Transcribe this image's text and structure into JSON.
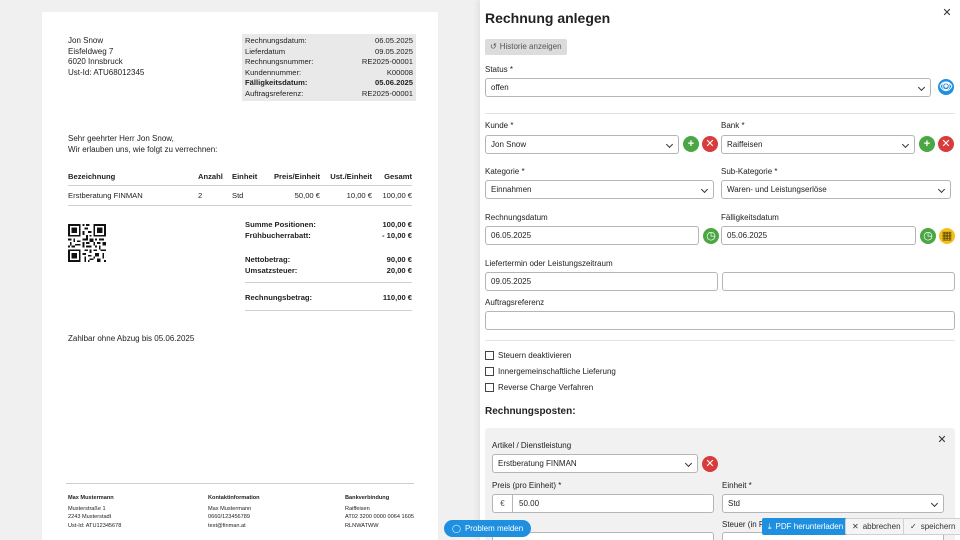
{
  "invoice": {
    "sender": [
      "Jon Snow",
      "Eisfeldweg 7",
      "6020 Innsbruck",
      "Ust-Id: ATU68012345"
    ],
    "meta": [
      {
        "label": "Rechnungsdatum:",
        "value": "06.05.2025"
      },
      {
        "label": "Lieferdatum",
        "value": "09.05.2025"
      },
      {
        "label": "Rechnungsnummer:",
        "value": "RE2025-00001"
      },
      {
        "label": "Kundennummer:",
        "value": "K00008"
      },
      {
        "label": "Fälligkeitsdatum:",
        "value": "05.06.2025"
      },
      {
        "label": "Auftragsreferenz:",
        "value": "RE2025-00001"
      }
    ],
    "greeting": [
      "Sehr geehrter Herr Jon Snow,",
      "Wir erlauben uns, wie folgt zu verrechnen:"
    ],
    "table": {
      "headers": [
        "Bezeichnung",
        "Anzahl",
        "Einheit",
        "Preis/Einheit",
        "Ust./Einheit",
        "Gesamt"
      ],
      "rows": [
        [
          "Erstberatung FINMAN",
          "2",
          "Std",
          "50,00 €",
          "10,00 €",
          "100,00 €"
        ]
      ]
    },
    "sums": [
      {
        "label": "Summe Positionen:",
        "value": "100,00 €"
      },
      {
        "label": "Frühbucherrabatt:",
        "value": "- 10,00 €"
      },
      {
        "label": "Nettobetrag:",
        "value": "90,00 €"
      },
      {
        "label": "Umsatzsteuer:",
        "value": "20,00 €"
      },
      {
        "label": "Rechnungsbetrag:",
        "value": "110,00 €"
      }
    ],
    "payment_note": "Zahlbar ohne Abzug bis 05.06.2025",
    "footer": {
      "col1": {
        "title": "Max Mustermann",
        "lines": [
          "Musterstraße 1",
          "2243 Musterstadt",
          "Ust-Id: ATU12345678"
        ]
      },
      "col2": {
        "title": "Kontaktinformation",
        "lines": [
          "Max Mustermann",
          "0660/123456789",
          "test@finman.at"
        ]
      },
      "col3": {
        "title": "Bankverbindung",
        "lines": [
          "Raiffeisen",
          "AT02 3200 0000 0064 1605",
          "RLNWATWW"
        ]
      }
    }
  },
  "panel": {
    "title": "Rechnung anlegen",
    "history_button": "Historie anzeigen",
    "status": {
      "label": "Status *",
      "value": "offen"
    },
    "kunde": {
      "label": "Kunde *",
      "value": "Jon Snow"
    },
    "bank": {
      "label": "Bank *",
      "value": "Raiffeisen"
    },
    "kategorie": {
      "label": "Kategorie *",
      "value": "Einnahmen"
    },
    "subkategorie": {
      "label": "Sub-Kategorie *",
      "value": "Waren- und Leistungserlöse"
    },
    "rechnungsdatum": {
      "label": "Rechnungsdatum",
      "value": "06.05.2025"
    },
    "faelligkeitsdatum": {
      "label": "Fälligkeitsdatum",
      "value": "05.06.2025"
    },
    "liefertermin": {
      "label": "Liefertermin oder Leistungszeitraum",
      "value": "09.05.2025",
      "value2": ""
    },
    "auftragsreferenz": {
      "label": "Auftragsreferenz",
      "value": ""
    },
    "checkboxes": [
      "Steuern deaktivieren",
      "Innergemeinschaftliche Lieferung",
      "Reverse Charge Verfahren"
    ],
    "positions_title": "Rechnungsposten:",
    "item": {
      "artikel_label": "Artikel / Dienstleistung",
      "artikel_value": "Erstberatung FINMAN",
      "preis_label": "Preis (pro Einheit) *",
      "currency": "€",
      "preis_value": "50.00",
      "einheit_label": "Einheit *",
      "einheit_value": "Std",
      "steuer_label": "Steuer (in Pro"
    }
  },
  "actions": {
    "problem": "Problem melden",
    "pdf": "PDF herunterladen",
    "cancel": "abbrechen",
    "save": "speichern"
  }
}
